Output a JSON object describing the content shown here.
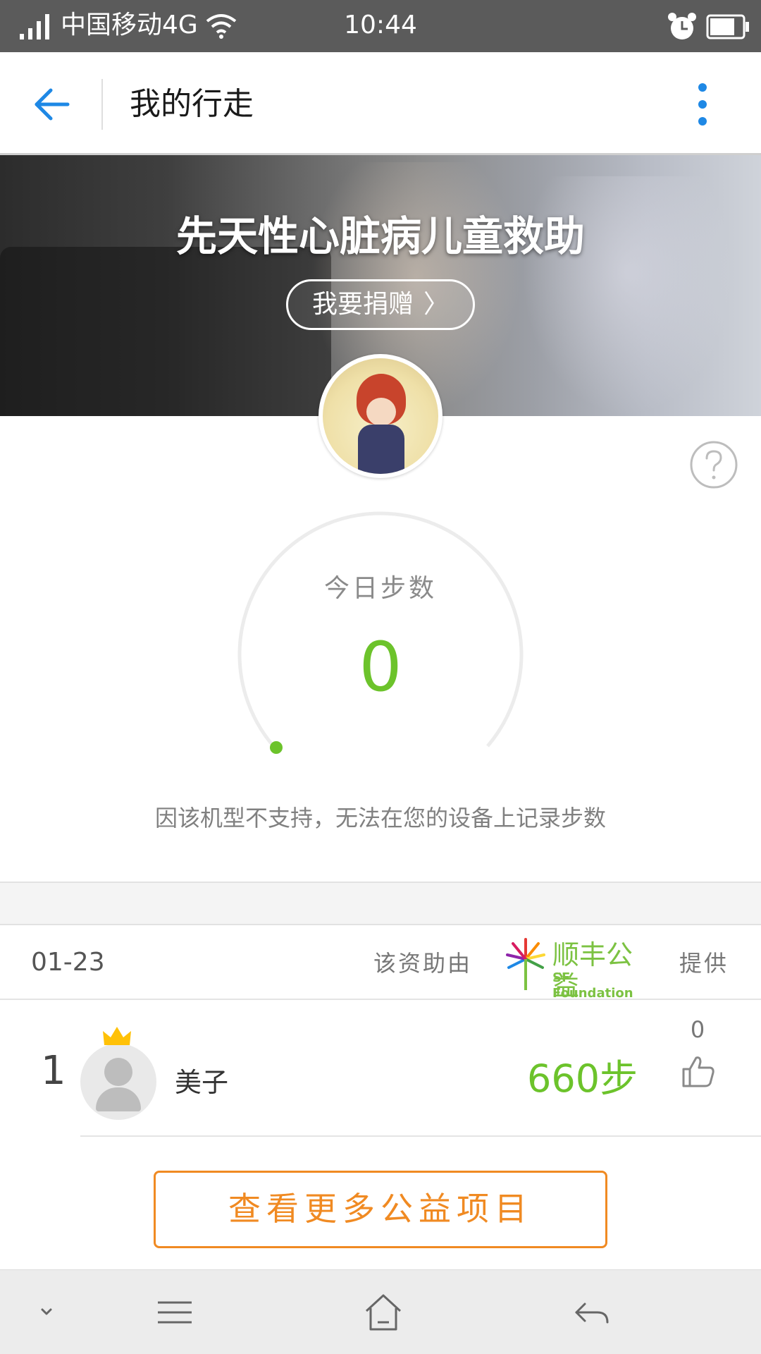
{
  "status_bar": {
    "carrier": "中国移动4G",
    "time": "10:44"
  },
  "header": {
    "title": "我的行走"
  },
  "banner": {
    "title": "先天性心脏病儿童救助",
    "donate_label": "我要捐赠",
    "donate_chevron": "〉"
  },
  "steps": {
    "label": "今日步数",
    "value": "0",
    "notice": "因该机型不支持，无法在您的设备上记录步数"
  },
  "sponsor": {
    "date": "01-23",
    "prefix": "该资助由",
    "logo_name": "顺丰公益",
    "logo_sub": "SF Foundation",
    "suffix": "提供"
  },
  "ranking": [
    {
      "rank": "1",
      "name": "美子",
      "steps": "660步",
      "likes": "0"
    }
  ],
  "actions": {
    "more_projects": "查看更多公益项目"
  },
  "colors": {
    "accent_blue": "#1e88e5",
    "step_green": "#6cc32b",
    "orange": "#f08a22",
    "status_bar": "#5b5b5b"
  },
  "icons": [
    "signal-icon",
    "wifi-icon",
    "alarm-icon",
    "battery-icon",
    "back-arrow-icon",
    "more-vertical-icon",
    "help-icon",
    "crown-icon",
    "thumbs-up-icon",
    "chevron-down-icon",
    "menu-icon",
    "home-icon",
    "back-icon"
  ]
}
